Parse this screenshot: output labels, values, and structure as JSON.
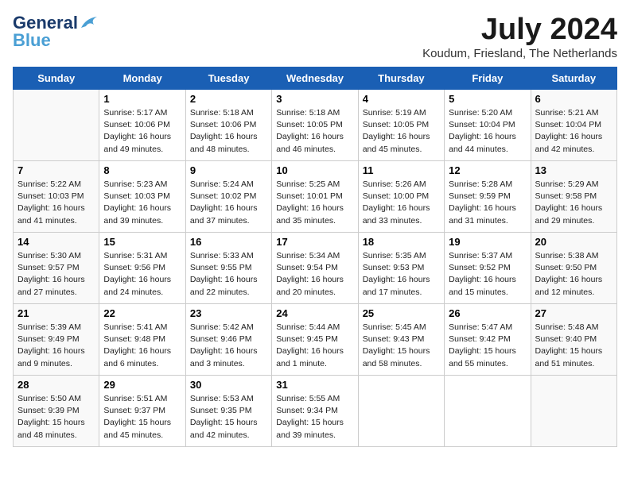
{
  "header": {
    "logo_line1": "General",
    "logo_line2": "Blue",
    "month": "July 2024",
    "location": "Koudum, Friesland, The Netherlands"
  },
  "days_of_week": [
    "Sunday",
    "Monday",
    "Tuesday",
    "Wednesday",
    "Thursday",
    "Friday",
    "Saturday"
  ],
  "weeks": [
    [
      {
        "day": "",
        "info": ""
      },
      {
        "day": "1",
        "info": "Sunrise: 5:17 AM\nSunset: 10:06 PM\nDaylight: 16 hours\nand 49 minutes."
      },
      {
        "day": "2",
        "info": "Sunrise: 5:18 AM\nSunset: 10:06 PM\nDaylight: 16 hours\nand 48 minutes."
      },
      {
        "day": "3",
        "info": "Sunrise: 5:18 AM\nSunset: 10:05 PM\nDaylight: 16 hours\nand 46 minutes."
      },
      {
        "day": "4",
        "info": "Sunrise: 5:19 AM\nSunset: 10:05 PM\nDaylight: 16 hours\nand 45 minutes."
      },
      {
        "day": "5",
        "info": "Sunrise: 5:20 AM\nSunset: 10:04 PM\nDaylight: 16 hours\nand 44 minutes."
      },
      {
        "day": "6",
        "info": "Sunrise: 5:21 AM\nSunset: 10:04 PM\nDaylight: 16 hours\nand 42 minutes."
      }
    ],
    [
      {
        "day": "7",
        "info": "Sunrise: 5:22 AM\nSunset: 10:03 PM\nDaylight: 16 hours\nand 41 minutes."
      },
      {
        "day": "8",
        "info": "Sunrise: 5:23 AM\nSunset: 10:03 PM\nDaylight: 16 hours\nand 39 minutes."
      },
      {
        "day": "9",
        "info": "Sunrise: 5:24 AM\nSunset: 10:02 PM\nDaylight: 16 hours\nand 37 minutes."
      },
      {
        "day": "10",
        "info": "Sunrise: 5:25 AM\nSunset: 10:01 PM\nDaylight: 16 hours\nand 35 minutes."
      },
      {
        "day": "11",
        "info": "Sunrise: 5:26 AM\nSunset: 10:00 PM\nDaylight: 16 hours\nand 33 minutes."
      },
      {
        "day": "12",
        "info": "Sunrise: 5:28 AM\nSunset: 9:59 PM\nDaylight: 16 hours\nand 31 minutes."
      },
      {
        "day": "13",
        "info": "Sunrise: 5:29 AM\nSunset: 9:58 PM\nDaylight: 16 hours\nand 29 minutes."
      }
    ],
    [
      {
        "day": "14",
        "info": "Sunrise: 5:30 AM\nSunset: 9:57 PM\nDaylight: 16 hours\nand 27 minutes."
      },
      {
        "day": "15",
        "info": "Sunrise: 5:31 AM\nSunset: 9:56 PM\nDaylight: 16 hours\nand 24 minutes."
      },
      {
        "day": "16",
        "info": "Sunrise: 5:33 AM\nSunset: 9:55 PM\nDaylight: 16 hours\nand 22 minutes."
      },
      {
        "day": "17",
        "info": "Sunrise: 5:34 AM\nSunset: 9:54 PM\nDaylight: 16 hours\nand 20 minutes."
      },
      {
        "day": "18",
        "info": "Sunrise: 5:35 AM\nSunset: 9:53 PM\nDaylight: 16 hours\nand 17 minutes."
      },
      {
        "day": "19",
        "info": "Sunrise: 5:37 AM\nSunset: 9:52 PM\nDaylight: 16 hours\nand 15 minutes."
      },
      {
        "day": "20",
        "info": "Sunrise: 5:38 AM\nSunset: 9:50 PM\nDaylight: 16 hours\nand 12 minutes."
      }
    ],
    [
      {
        "day": "21",
        "info": "Sunrise: 5:39 AM\nSunset: 9:49 PM\nDaylight: 16 hours\nand 9 minutes."
      },
      {
        "day": "22",
        "info": "Sunrise: 5:41 AM\nSunset: 9:48 PM\nDaylight: 16 hours\nand 6 minutes."
      },
      {
        "day": "23",
        "info": "Sunrise: 5:42 AM\nSunset: 9:46 PM\nDaylight: 16 hours\nand 3 minutes."
      },
      {
        "day": "24",
        "info": "Sunrise: 5:44 AM\nSunset: 9:45 PM\nDaylight: 16 hours\nand 1 minute."
      },
      {
        "day": "25",
        "info": "Sunrise: 5:45 AM\nSunset: 9:43 PM\nDaylight: 15 hours\nand 58 minutes."
      },
      {
        "day": "26",
        "info": "Sunrise: 5:47 AM\nSunset: 9:42 PM\nDaylight: 15 hours\nand 55 minutes."
      },
      {
        "day": "27",
        "info": "Sunrise: 5:48 AM\nSunset: 9:40 PM\nDaylight: 15 hours\nand 51 minutes."
      }
    ],
    [
      {
        "day": "28",
        "info": "Sunrise: 5:50 AM\nSunset: 9:39 PM\nDaylight: 15 hours\nand 48 minutes."
      },
      {
        "day": "29",
        "info": "Sunrise: 5:51 AM\nSunset: 9:37 PM\nDaylight: 15 hours\nand 45 minutes."
      },
      {
        "day": "30",
        "info": "Sunrise: 5:53 AM\nSunset: 9:35 PM\nDaylight: 15 hours\nand 42 minutes."
      },
      {
        "day": "31",
        "info": "Sunrise: 5:55 AM\nSunset: 9:34 PM\nDaylight: 15 hours\nand 39 minutes."
      },
      {
        "day": "",
        "info": ""
      },
      {
        "day": "",
        "info": ""
      },
      {
        "day": "",
        "info": ""
      }
    ]
  ]
}
